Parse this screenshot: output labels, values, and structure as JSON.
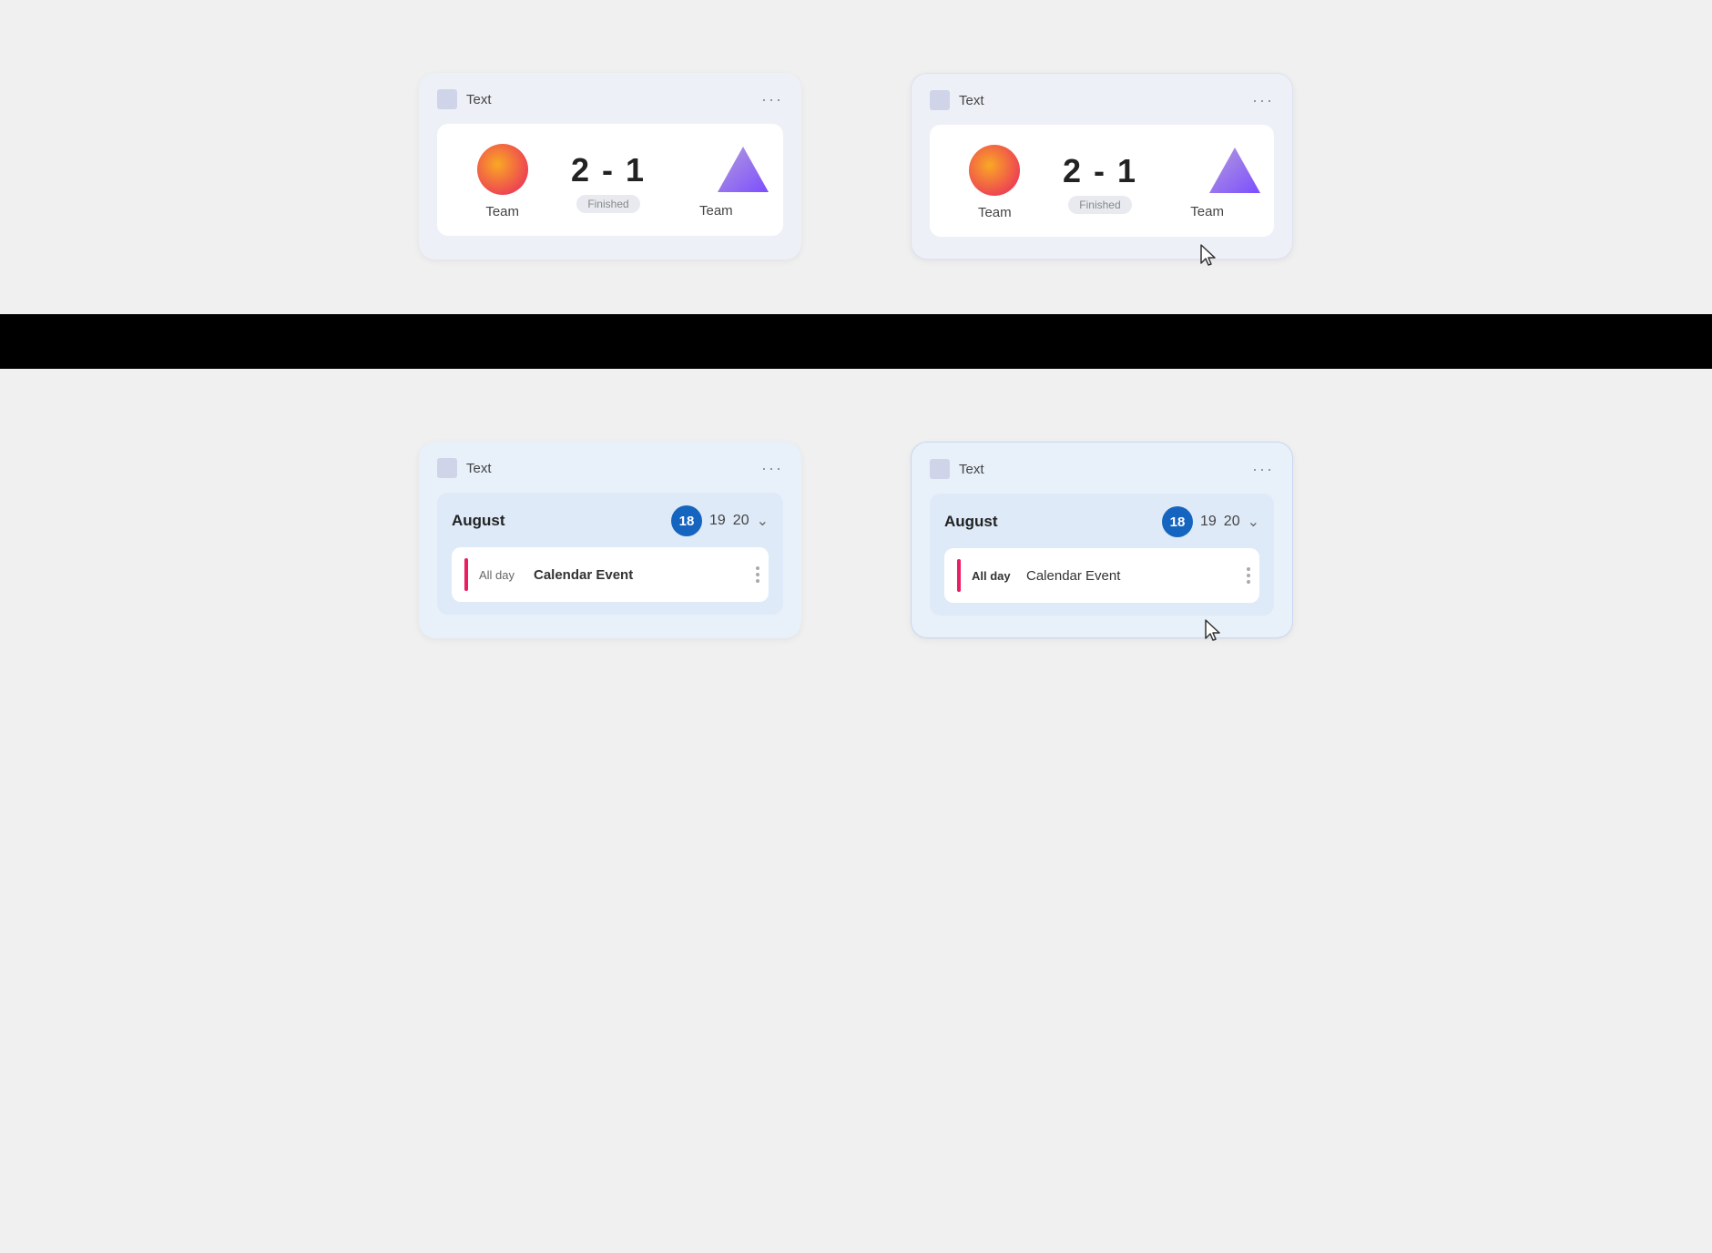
{
  "cards": {
    "score_card_1": {
      "title": "Text",
      "menu_icon": "···",
      "team1_label": "Team",
      "team2_label": "Team",
      "score": "2 - 1",
      "status": "Finished"
    },
    "score_card_2": {
      "title": "Text",
      "menu_icon": "···",
      "team1_label": "Team",
      "team2_label": "Team",
      "score": "2 - 1",
      "status": "Finished"
    },
    "calendar_card_1": {
      "title": "Text",
      "menu_icon": "···",
      "month": "August",
      "date1": "18",
      "date2": "19",
      "date3": "20",
      "allday_label": "All day",
      "event_name": "Calendar Event"
    },
    "calendar_card_2": {
      "title": "Text",
      "menu_icon": "···",
      "month": "August",
      "date1": "18",
      "date2": "19",
      "date3": "20",
      "allday_label": "All day",
      "event_name": "Calendar Event"
    }
  }
}
